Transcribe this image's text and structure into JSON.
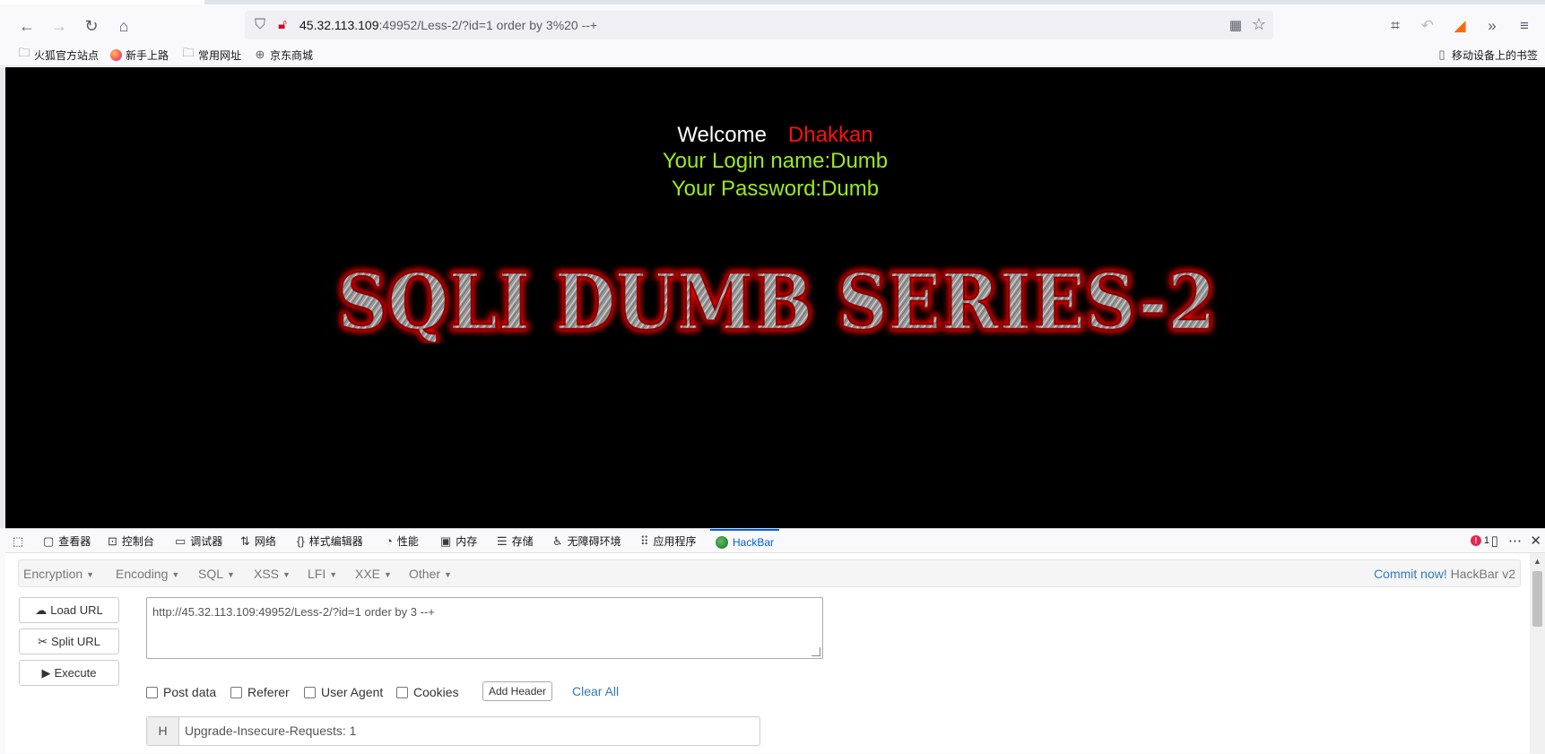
{
  "browser": {
    "url_host": "45.32.113.109",
    "url_rest": ":49952/Less-2/?id=1 order by 3%20 --+",
    "bookmarks": [
      "火狐官方站点",
      "新手上路",
      "常用网址",
      "京东商城"
    ],
    "mobile_bookmarks": "移动设备上的书签"
  },
  "page": {
    "welcome": "Welcome",
    "user_name": "Dhakkan",
    "login_line": "Your Login name:Dumb",
    "password_line": "Your Password:Dumb",
    "logo_text": "SQLI DUMB SERIES-2"
  },
  "devtools": {
    "tabs": [
      "查看器",
      "控制台",
      "调试器",
      "网络",
      "样式编辑器",
      "性能",
      "内存",
      "存储",
      "无障碍环境",
      "应用程序",
      "HackBar"
    ],
    "error_count": "1",
    "icons": {
      "accent": "#0061e0",
      "error": "#e22850"
    }
  },
  "hackbar": {
    "menu": [
      "Encryption",
      "Encoding",
      "SQL",
      "XSS",
      "LFI",
      "XXE",
      "Other"
    ],
    "commit_link": "Commit now!",
    "commit_suffix": " HackBar v2",
    "load_url": "Load URL",
    "split_url": "Split URL",
    "execute": "Execute",
    "url_value": "http://45.32.113.109:49952/Less-2/?id=1 order by 3 --+",
    "checks": [
      "Post data",
      "Referer",
      "User Agent",
      "Cookies"
    ],
    "add_header": "Add Header",
    "clear_all": "Clear All",
    "header_key": "H",
    "header_value": "Upgrade-Insecure-Requests: 1"
  },
  "colors": {
    "welcome_name": "#ff1010",
    "green_text": "#9aea20",
    "link": "#337ab7"
  }
}
